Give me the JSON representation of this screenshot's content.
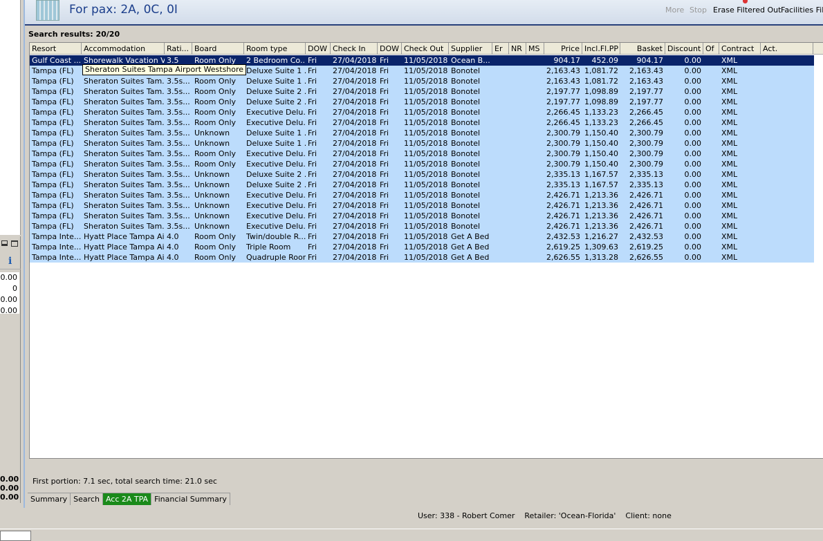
{
  "header": {
    "title": "For pax: 2A, 0C, 0I",
    "toolbar": [
      "More",
      "Stop",
      "Erase Filtered Out",
      "Facilities Filte"
    ]
  },
  "results_label": "Search results: 20/20",
  "columns": [
    "Resort",
    "Accommodation",
    "Rati...",
    "Board",
    "Room type",
    "DOW",
    "Check In",
    "DOW",
    "Check Out",
    "Supplier",
    "Er",
    "NR",
    "MS",
    "Price",
    "Incl.Fl.PP",
    "Basket",
    "Discount",
    "Of",
    "Contract",
    "Act. Supplier"
  ],
  "rows": [
    [
      "Gulf Coast ...",
      "Shorewalk Vacation V...",
      "3.5",
      "Room Only",
      "2 Bedroom Co...",
      "Fri",
      "27/04/2018",
      "Fri",
      "11/05/2018",
      "Ocean B...",
      "",
      "",
      "",
      "904.17",
      "452.09",
      "904.17",
      "0.00",
      "",
      "XML",
      ""
    ],
    [
      "Tampa (FL)",
      "Sheraton Suites Tam...",
      "3.5s...",
      "Room Only",
      "Deluxe Suite 1 ...",
      "Fri",
      "27/04/2018",
      "Fri",
      "11/05/2018",
      "Bonotel",
      "",
      "",
      "",
      "2,163.43",
      "1,081.72",
      "2,163.43",
      "0.00",
      "",
      "XML",
      ""
    ],
    [
      "Tampa (FL)",
      "Sheraton Suites Tam...",
      "3.5s...",
      "Room Only",
      "Deluxe Suite 1 ...",
      "Fri",
      "27/04/2018",
      "Fri",
      "11/05/2018",
      "Bonotel",
      "",
      "",
      "",
      "2,163.43",
      "1,081.72",
      "2,163.43",
      "0.00",
      "",
      "XML",
      ""
    ],
    [
      "Tampa (FL)",
      "Sheraton Suites Tam...",
      "3.5s...",
      "Room Only",
      "Deluxe Suite 2 ...",
      "Fri",
      "27/04/2018",
      "Fri",
      "11/05/2018",
      "Bonotel",
      "",
      "",
      "",
      "2,197.77",
      "1,098.89",
      "2,197.77",
      "0.00",
      "",
      "XML",
      ""
    ],
    [
      "Tampa (FL)",
      "Sheraton Suites Tam...",
      "3.5s...",
      "Room Only",
      "Deluxe Suite 2 ...",
      "Fri",
      "27/04/2018",
      "Fri",
      "11/05/2018",
      "Bonotel",
      "",
      "",
      "",
      "2,197.77",
      "1,098.89",
      "2,197.77",
      "0.00",
      "",
      "XML",
      ""
    ],
    [
      "Tampa (FL)",
      "Sheraton Suites Tam...",
      "3.5s...",
      "Room Only",
      "Executive Delu...",
      "Fri",
      "27/04/2018",
      "Fri",
      "11/05/2018",
      "Bonotel",
      "",
      "",
      "",
      "2,266.45",
      "1,133.23",
      "2,266.45",
      "0.00",
      "",
      "XML",
      ""
    ],
    [
      "Tampa (FL)",
      "Sheraton Suites Tam...",
      "3.5s...",
      "Room Only",
      "Executive Delu...",
      "Fri",
      "27/04/2018",
      "Fri",
      "11/05/2018",
      "Bonotel",
      "",
      "",
      "",
      "2,266.45",
      "1,133.23",
      "2,266.45",
      "0.00",
      "",
      "XML",
      ""
    ],
    [
      "Tampa (FL)",
      "Sheraton Suites Tam...",
      "3.5s...",
      "Unknown",
      "Deluxe Suite 1 ...",
      "Fri",
      "27/04/2018",
      "Fri",
      "11/05/2018",
      "Bonotel",
      "",
      "",
      "",
      "2,300.79",
      "1,150.40",
      "2,300.79",
      "0.00",
      "",
      "XML",
      ""
    ],
    [
      "Tampa (FL)",
      "Sheraton Suites Tam...",
      "3.5s...",
      "Unknown",
      "Deluxe Suite 1 ...",
      "Fri",
      "27/04/2018",
      "Fri",
      "11/05/2018",
      "Bonotel",
      "",
      "",
      "",
      "2,300.79",
      "1,150.40",
      "2,300.79",
      "0.00",
      "",
      "XML",
      ""
    ],
    [
      "Tampa (FL)",
      "Sheraton Suites Tam...",
      "3.5s...",
      "Room Only",
      "Executive Delu...",
      "Fri",
      "27/04/2018",
      "Fri",
      "11/05/2018",
      "Bonotel",
      "",
      "",
      "",
      "2,300.79",
      "1,150.40",
      "2,300.79",
      "0.00",
      "",
      "XML",
      ""
    ],
    [
      "Tampa (FL)",
      "Sheraton Suites Tam...",
      "3.5s...",
      "Room Only",
      "Executive Delu...",
      "Fri",
      "27/04/2018",
      "Fri",
      "11/05/2018",
      "Bonotel",
      "",
      "",
      "",
      "2,300.79",
      "1,150.40",
      "2,300.79",
      "0.00",
      "",
      "XML",
      ""
    ],
    [
      "Tampa (FL)",
      "Sheraton Suites Tam...",
      "3.5s...",
      "Unknown",
      "Deluxe Suite 2 ...",
      "Fri",
      "27/04/2018",
      "Fri",
      "11/05/2018",
      "Bonotel",
      "",
      "",
      "",
      "2,335.13",
      "1,167.57",
      "2,335.13",
      "0.00",
      "",
      "XML",
      ""
    ],
    [
      "Tampa (FL)",
      "Sheraton Suites Tam...",
      "3.5s...",
      "Unknown",
      "Deluxe Suite 2 ...",
      "Fri",
      "27/04/2018",
      "Fri",
      "11/05/2018",
      "Bonotel",
      "",
      "",
      "",
      "2,335.13",
      "1,167.57",
      "2,335.13",
      "0.00",
      "",
      "XML",
      ""
    ],
    [
      "Tampa (FL)",
      "Sheraton Suites Tam...",
      "3.5s...",
      "Unknown",
      "Executive Delu...",
      "Fri",
      "27/04/2018",
      "Fri",
      "11/05/2018",
      "Bonotel",
      "",
      "",
      "",
      "2,426.71",
      "1,213.36",
      "2,426.71",
      "0.00",
      "",
      "XML",
      ""
    ],
    [
      "Tampa (FL)",
      "Sheraton Suites Tam...",
      "3.5s...",
      "Unknown",
      "Executive Delu...",
      "Fri",
      "27/04/2018",
      "Fri",
      "11/05/2018",
      "Bonotel",
      "",
      "",
      "",
      "2,426.71",
      "1,213.36",
      "2,426.71",
      "0.00",
      "",
      "XML",
      ""
    ],
    [
      "Tampa (FL)",
      "Sheraton Suites Tam...",
      "3.5s...",
      "Unknown",
      "Executive Delu...",
      "Fri",
      "27/04/2018",
      "Fri",
      "11/05/2018",
      "Bonotel",
      "",
      "",
      "",
      "2,426.71",
      "1,213.36",
      "2,426.71",
      "0.00",
      "",
      "XML",
      ""
    ],
    [
      "Tampa (FL)",
      "Sheraton Suites Tam...",
      "3.5s...",
      "Unknown",
      "Executive Delu...",
      "Fri",
      "27/04/2018",
      "Fri",
      "11/05/2018",
      "Bonotel",
      "",
      "",
      "",
      "2,426.71",
      "1,213.36",
      "2,426.71",
      "0.00",
      "",
      "XML",
      ""
    ],
    [
      "Tampa Inte...",
      "Hyatt Place Tampa Ai...",
      "4.0",
      "Room Only",
      "Twin/double R...",
      "Fri",
      "27/04/2018",
      "Fri",
      "11/05/2018",
      "Get A Bed",
      "",
      "",
      "",
      "2,432.53",
      "1,216.27",
      "2,432.53",
      "0.00",
      "",
      "XML",
      ""
    ],
    [
      "Tampa Inte...",
      "Hyatt Place Tampa Ai...",
      "4.0",
      "Room Only",
      "Triple Room",
      "Fri",
      "27/04/2018",
      "Fri",
      "11/05/2018",
      "Get A Bed",
      "",
      "",
      "",
      "2,619.25",
      "1,309.63",
      "2,619.25",
      "0.00",
      "",
      "XML",
      ""
    ],
    [
      "Tampa Inte...",
      "Hyatt Place Tampa Ai...",
      "4.0",
      "Room Only",
      "Quadruple Room",
      "Fri",
      "27/04/2018",
      "Fri",
      "11/05/2018",
      "Get A Bed",
      "",
      "",
      "",
      "2,626.55",
      "1,313.28",
      "2,626.55",
      "0.00",
      "",
      "XML",
      ""
    ]
  ],
  "tooltip": "Sheraton Suites Tampa Airport Westshore",
  "left_values": [
    "0.00",
    "0",
    "0.00",
    "0.00"
  ],
  "left_totals": [
    "0.00",
    "0.00",
    "0.00"
  ],
  "footer": "First portion: 7.1 sec, total search time: 21.0 sec",
  "tabs": [
    {
      "label": "Summary"
    },
    {
      "label": "Search"
    },
    {
      "label": "Acc 2A TPA",
      "active": true
    },
    {
      "label": "Financial Summary"
    }
  ],
  "status": "User: 338 - Robert Comer    Retailer: 'Ocean-Florida'    Client: none",
  "colors": {
    "selected_row": "#0a246a",
    "row": "#bcdcfc",
    "active_tab": "#1a8a1a",
    "title": "#1c3f8c"
  }
}
